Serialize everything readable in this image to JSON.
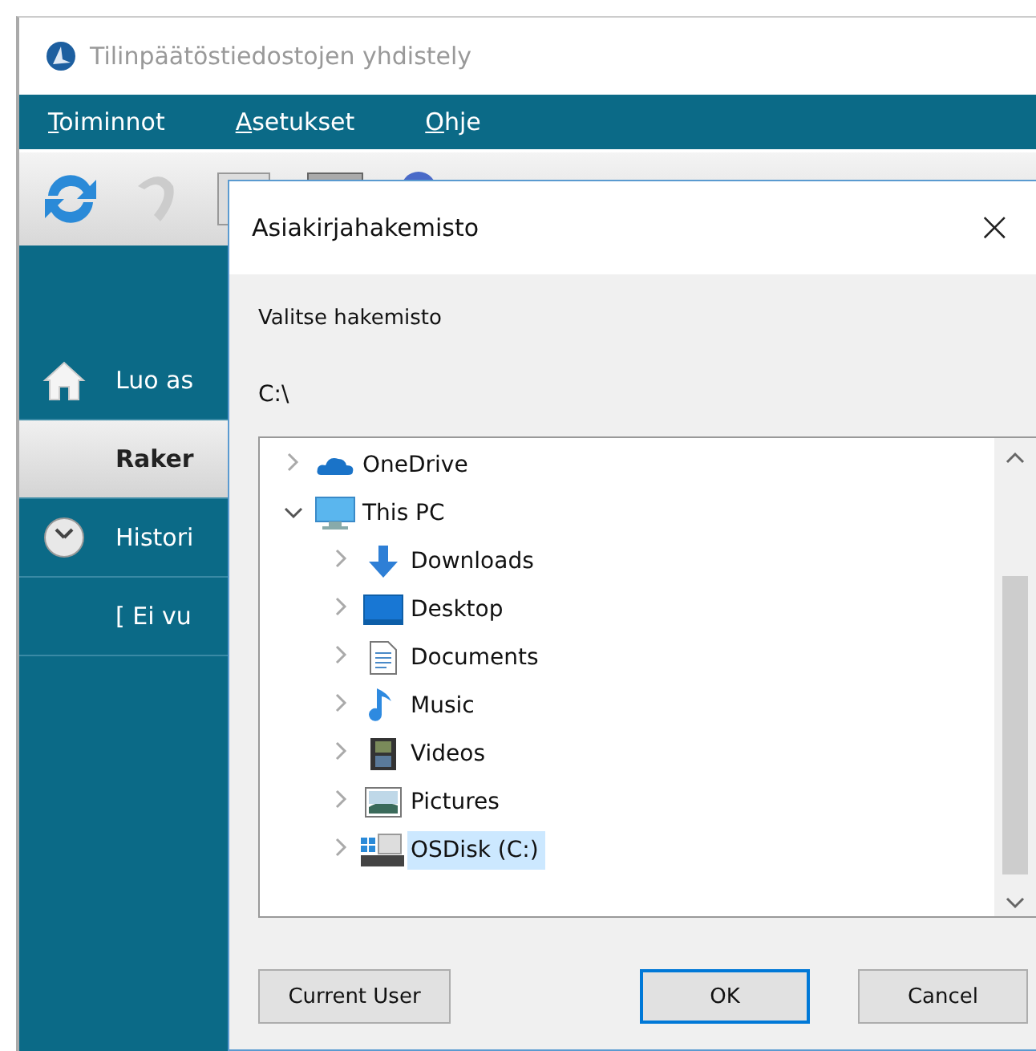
{
  "app": {
    "title": "Tilinpäätöstiedostojen yhdistely",
    "menu": [
      {
        "label": "Toiminnot"
      },
      {
        "label": "Asetukset"
      },
      {
        "label": "Ohje"
      }
    ],
    "sidebar": [
      {
        "kind": "home",
        "label": "Luo as",
        "selected": false
      },
      {
        "kind": "plain",
        "label": "Raker",
        "selected": true
      },
      {
        "kind": "clock",
        "label": "Histori",
        "selected": false
      },
      {
        "kind": "plain",
        "label": "[ Ei vu",
        "selected": false
      }
    ]
  },
  "dialog": {
    "title": "Asiakirjahakemisto",
    "close": "×",
    "prompt": "Valitse hakemisto",
    "path": "C:\\",
    "tree": [
      {
        "kind": "onedrive",
        "label": "OneDrive",
        "expanded": false,
        "selected": false
      },
      {
        "kind": "computer",
        "label": "This PC",
        "expanded": true,
        "selected": false,
        "children": [
          {
            "kind": "downloads",
            "label": "Downloads",
            "expanded": false,
            "selected": false
          },
          {
            "kind": "desktop",
            "label": "Desktop",
            "expanded": false,
            "selected": false
          },
          {
            "kind": "documents",
            "label": "Documents",
            "expanded": false,
            "selected": false
          },
          {
            "kind": "music",
            "label": "Music",
            "expanded": false,
            "selected": false
          },
          {
            "kind": "videos",
            "label": "Videos",
            "expanded": false,
            "selected": false
          },
          {
            "kind": "pictures",
            "label": "Pictures",
            "expanded": false,
            "selected": false
          },
          {
            "kind": "drive",
            "label": "OSDisk (C:)",
            "expanded": false,
            "selected": true
          }
        ]
      }
    ],
    "buttons": [
      {
        "label": "Current User",
        "kind": "side",
        "focused": false
      },
      {
        "label": "OK",
        "kind": "main",
        "focused": true
      },
      {
        "label": "Cancel",
        "kind": "main",
        "focused": false
      }
    ]
  }
}
